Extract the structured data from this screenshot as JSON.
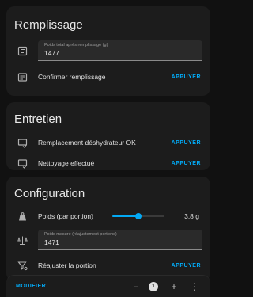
{
  "cards": {
    "remplissage": {
      "title": "Remplissage",
      "field": {
        "label": "Poids total après remplissage (g)",
        "value": "1477"
      },
      "confirm": {
        "label": "Confirmer remplissage",
        "action": "APPUYER"
      }
    },
    "entretien": {
      "title": "Entretien",
      "items": [
        {
          "label": "Remplacement déshydrateur OK",
          "action": "APPUYER"
        },
        {
          "label": "Nettoyage effectué",
          "action": "APPUYER"
        }
      ]
    },
    "configuration": {
      "title": "Configuration",
      "slider": {
        "label": "Poids (par portion)",
        "value_text": "3,8 g",
        "fraction": 0.5
      },
      "field": {
        "label": "Poids mesuré (réajustement portions)",
        "value": "1471"
      },
      "adjust": {
        "label": "Réajuster la portion",
        "action": "APPUYER"
      }
    }
  },
  "footer": {
    "modify": "MODIFIER",
    "count": "1",
    "minus": "−",
    "plus": "+",
    "more": "⋮"
  },
  "colors": {
    "accent": "#03a9f4",
    "card": "#1c1c1c",
    "background": "#111111"
  }
}
